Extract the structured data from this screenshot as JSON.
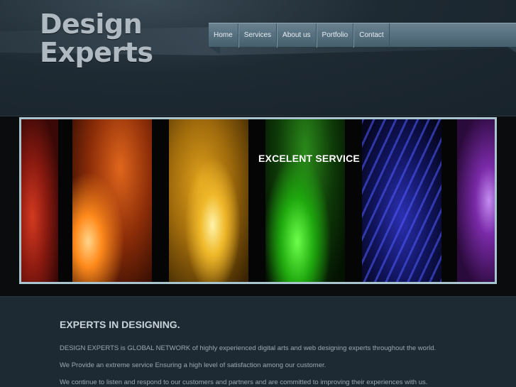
{
  "logo": {
    "line1": "Design",
    "line2": "Experts"
  },
  "nav": {
    "items": [
      {
        "label": "Home"
      },
      {
        "label": "Services"
      },
      {
        "label": "About us"
      },
      {
        "label": "Portfolio"
      },
      {
        "label": "Contact"
      }
    ]
  },
  "banner": {
    "title": "EXCELENT SERVICE"
  },
  "content": {
    "heading": "EXPERTS IN DESIGNING.",
    "paragraphs": [
      "DESIGN EXPERTS is GLOBAL NETWORK of highly experienced digital arts and web designing experts throughout the world.",
      "We Provide an extreme service Ensuring a high level of satisfaction among our customer.",
      "We continue to listen and respond to our customers and partners and are committed to improving their experiences with us."
    ]
  },
  "colors": {
    "background": "#1e2a33",
    "nav": "#56707f",
    "banner_border": "#a9c6d0",
    "heading": "#c9d3da",
    "text": "#9aa8b2"
  }
}
